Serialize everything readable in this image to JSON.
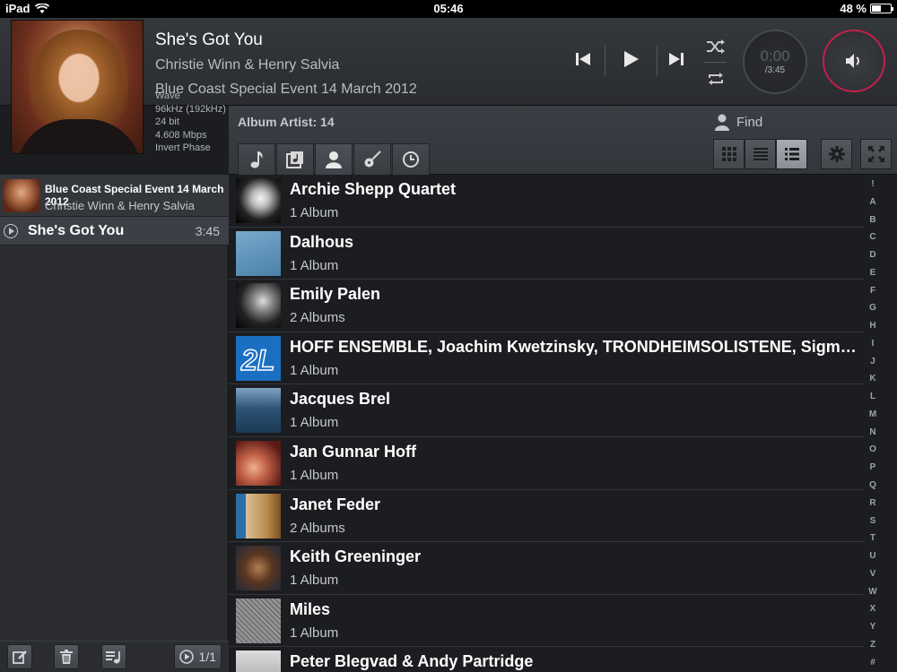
{
  "status": {
    "device": "iPad",
    "time": "05:46",
    "battery": "48 %"
  },
  "now_playing": {
    "title": "She's Got You",
    "artist": "Christie Winn & Henry Salvia",
    "album": "Blue Coast Special Event 14 March 2012",
    "tech": [
      "Wave",
      "96kHz (192kHz)",
      "24 bit",
      "4.608 Mbps",
      "Invert Phase"
    ],
    "elapsed": "0:00",
    "duration": "/3:45"
  },
  "browser": {
    "label": "Album Artist: 14",
    "find_label": "Find",
    "tabs": [
      "note-icon",
      "music-folder-icon",
      "person-icon",
      "guitar-icon",
      "clock-icon"
    ],
    "active_tab": 2
  },
  "queue": {
    "album_title": "Blue Coast Special Event 14 March 2012",
    "album_artist": "Christie Winn & Henry Salvia",
    "track_name": "She's Got You",
    "track_time": "3:45",
    "page": "1/1"
  },
  "artists": [
    {
      "name": "Archie Shepp Quartet",
      "count": "1 Album",
      "thumb": "#ddd"
    },
    {
      "name": "Dalhous",
      "count": "1 Album",
      "thumb": "#5a8fb5"
    },
    {
      "name": "Emily Palen",
      "count": "2 Albums",
      "thumb": "#777"
    },
    {
      "name": "HOFF ENSEMBLE, Joachim Kwetzinsky, TRONDHEIMSOLISTENE, Sigmund Groven, Sigmund Groven",
      "count": "1 Album",
      "thumb": "#1b6fc2"
    },
    {
      "name": "Jacques Brel",
      "count": "1 Album",
      "thumb": "#3d6a8f"
    },
    {
      "name": "Jan Gunnar Hoff",
      "count": "1 Album",
      "thumb": "#9b3b2a"
    },
    {
      "name": "Janet Feder",
      "count": "2 Albums",
      "thumb": "#c8902c"
    },
    {
      "name": "Keith Greeninger",
      "count": "1 Album",
      "thumb": "#5a3b2a"
    },
    {
      "name": "Miles",
      "count": "1 Album",
      "thumb": "#8a8a8a"
    },
    {
      "name": "Peter Blegvad & Andy Partridge",
      "count": "",
      "thumb": "#c8c8c8"
    }
  ],
  "az_index": [
    "!",
    "A",
    "B",
    "C",
    "D",
    "E",
    "F",
    "G",
    "H",
    "I",
    "J",
    "K",
    "L",
    "M",
    "N",
    "O",
    "P",
    "Q",
    "R",
    "S",
    "T",
    "U",
    "V",
    "W",
    "X",
    "Y",
    "Z",
    "#"
  ],
  "colors": {
    "accent": "#c4204a",
    "background": "#1c1d20",
    "panel": "#2a2c30"
  }
}
